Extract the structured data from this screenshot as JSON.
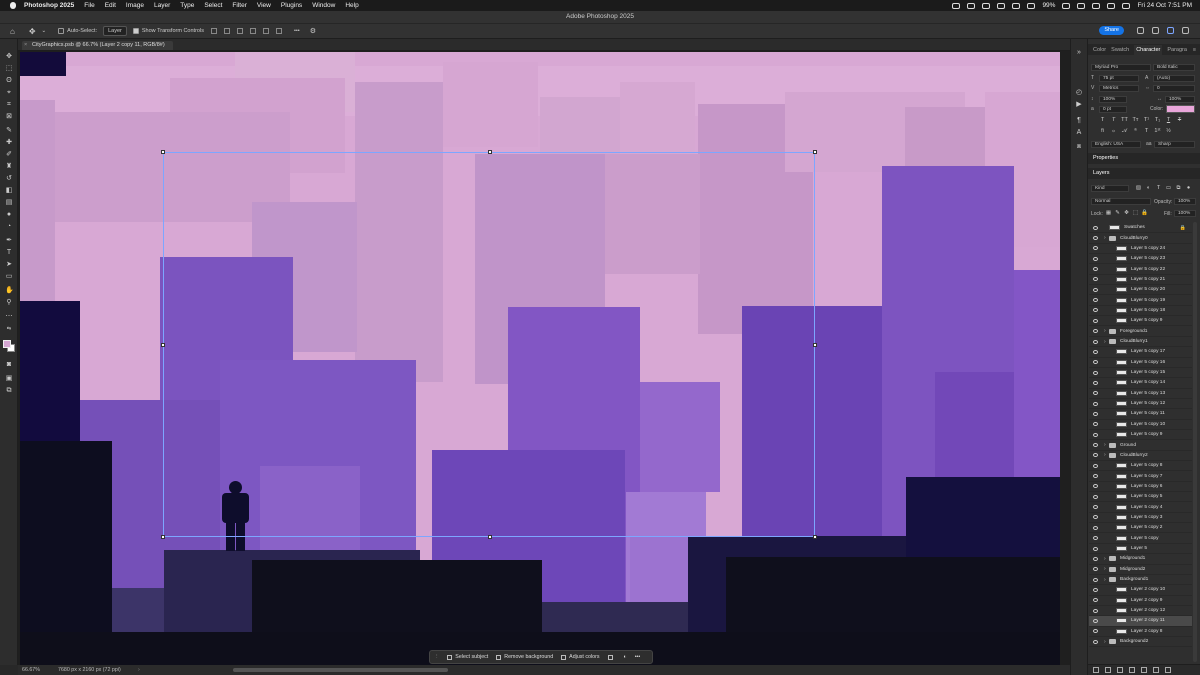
{
  "menubar": {
    "app": "Photoshop 2025",
    "items": [
      "File",
      "Edit",
      "Image",
      "Layer",
      "Type",
      "Select",
      "Filter",
      "View",
      "Plugins",
      "Window",
      "Help"
    ],
    "battery": "99%",
    "input": "ABC",
    "datetime": "Fri 24 Oct  7:51 PM"
  },
  "window": {
    "title": "Adobe Photoshop 2025"
  },
  "options": {
    "auto_select": "Auto-Select:",
    "layer_select": "Layer",
    "show_transform": "Show Transform Controls",
    "share": "Share"
  },
  "document": {
    "tab": "CityGraphics.psb @ 66.7% (Layer 2 copy 11, RGB/8#)",
    "zoom": "66.67%",
    "dimensions": "7680 px x 2160 px (72 ppi)"
  },
  "contextbar": {
    "select_subject": "Select subject",
    "remove_background": "Remove background",
    "adjust_colors": "Adjust colors"
  },
  "panels": {
    "tabs": [
      "Color",
      "Swatch",
      "Character",
      "Paragra"
    ],
    "active_tab": "Character",
    "properties": "Properties",
    "layers": "Layers"
  },
  "character": {
    "font": "Myriad Pro",
    "style": "Bold Italic",
    "size": "75 pt",
    "leading": "(Auto)",
    "kerning": "Metrics",
    "tracking": "0",
    "vscale": "100%",
    "hscale": "100%",
    "baseline": "0 pt",
    "color_label": "Color:",
    "color": "#e9a6da",
    "language": "English: USA",
    "aa": "Sharp"
  },
  "layers_panel": {
    "filter": "Kind",
    "blend": "Normal",
    "opacity_label": "Opacity:",
    "opacity": "100%",
    "lock_label": "Lock:",
    "fill_label": "Fill:",
    "fill": "100%",
    "items": [
      {
        "name": "Swatches",
        "type": "layer"
      },
      {
        "name": "CloudBlurry0",
        "type": "group"
      },
      {
        "name": "Layer 5 copy 24",
        "type": "layer"
      },
      {
        "name": "Layer 5 copy 23",
        "type": "layer"
      },
      {
        "name": "Layer 5 copy 22",
        "type": "layer"
      },
      {
        "name": "Layer 5 copy 21",
        "type": "layer"
      },
      {
        "name": "Layer 5 copy 20",
        "type": "layer"
      },
      {
        "name": "Layer 5 copy 19",
        "type": "layer"
      },
      {
        "name": "Layer 5 copy 18",
        "type": "layer"
      },
      {
        "name": "Layer 5 copy 9",
        "type": "layer"
      },
      {
        "name": "Foreground1",
        "type": "group"
      },
      {
        "name": "CloudBlurry1",
        "type": "group"
      },
      {
        "name": "Layer 5 copy 17",
        "type": "layer"
      },
      {
        "name": "Layer 5 copy 16",
        "type": "layer"
      },
      {
        "name": "Layer 5 copy 15",
        "type": "layer"
      },
      {
        "name": "Layer 5 copy 14",
        "type": "layer"
      },
      {
        "name": "Layer 5 copy 13",
        "type": "layer"
      },
      {
        "name": "Layer 5 copy 12",
        "type": "layer"
      },
      {
        "name": "Layer 5 copy 11",
        "type": "layer"
      },
      {
        "name": "Layer 5 copy 10",
        "type": "layer"
      },
      {
        "name": "Layer 5 copy 9",
        "type": "layer"
      },
      {
        "name": "Ground",
        "type": "group"
      },
      {
        "name": "CloudBlurry2",
        "type": "group"
      },
      {
        "name": "Layer 5 copy 8",
        "type": "layer"
      },
      {
        "name": "Layer 5 copy 7",
        "type": "layer"
      },
      {
        "name": "Layer 5 copy 6",
        "type": "layer"
      },
      {
        "name": "Layer 5 copy 5",
        "type": "layer"
      },
      {
        "name": "Layer 5 copy 4",
        "type": "layer"
      },
      {
        "name": "Layer 5 copy 3",
        "type": "layer"
      },
      {
        "name": "Layer 5 copy 2",
        "type": "layer"
      },
      {
        "name": "Layer 5 copy",
        "type": "layer"
      },
      {
        "name": "Layer 5",
        "type": "layer"
      },
      {
        "name": "Midground1",
        "type": "group"
      },
      {
        "name": "Midground2",
        "type": "group"
      },
      {
        "name": "Background1",
        "type": "group"
      },
      {
        "name": "Layer 2 copy 10",
        "type": "layer"
      },
      {
        "name": "Layer 2 copy 9",
        "type": "layer"
      },
      {
        "name": "Layer 2 copy 12",
        "type": "layer"
      },
      {
        "name": "Layer 2 copy 11",
        "type": "layer",
        "selected": true
      },
      {
        "name": "Layer 2 copy 8",
        "type": "layer"
      },
      {
        "name": "Background2",
        "type": "group"
      }
    ]
  }
}
